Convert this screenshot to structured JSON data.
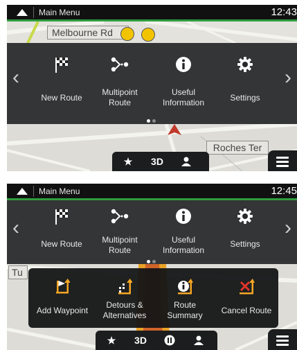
{
  "colors": {
    "accent_green": "#2e9d3e",
    "accent_orange": "#f5a623",
    "cancel_red": "#e0342b",
    "panel_dark": "#26282a"
  },
  "screens": [
    {
      "status": {
        "title": "Main Menu",
        "time": "12:43"
      },
      "map": {
        "street_1": "Melbourne Rd",
        "street_2": "Roches Ter"
      },
      "menu": {
        "items": [
          {
            "label": "New Route",
            "icon": "checkered-flag-icon"
          },
          {
            "label_line1": "Multipoint",
            "label_line2": "Route",
            "icon": "multipoint-icon"
          },
          {
            "label_line1": "Useful",
            "label_line2": "Information",
            "icon": "info-icon"
          },
          {
            "label": "Settings",
            "icon": "gear-icon"
          }
        ]
      },
      "bottom_bar": {
        "star": "★",
        "view_mode": "3D",
        "person": "person-icon"
      }
    },
    {
      "status": {
        "title": "Main Menu",
        "time": "12:45"
      },
      "map": {
        "street_1": "Tu"
      },
      "menu": {
        "items": [
          {
            "label": "New Route",
            "icon": "checkered-flag-icon"
          },
          {
            "label_line1": "Multipoint",
            "label_line2": "Route",
            "icon": "multipoint-icon"
          },
          {
            "label_line1": "Useful",
            "label_line2": "Information",
            "icon": "info-icon"
          },
          {
            "label": "Settings",
            "icon": "gear-icon"
          }
        ]
      },
      "route_menu": {
        "items": [
          {
            "label": "Add Waypoint",
            "icon": "add-waypoint-icon"
          },
          {
            "label_line1": "Detours &",
            "label_line2": "Alternatives",
            "icon": "detours-icon"
          },
          {
            "label_line1": "Route",
            "label_line2": "Summary",
            "icon": "route-summary-icon"
          },
          {
            "label": "Cancel Route",
            "icon": "cancel-route-icon"
          }
        ]
      },
      "bottom_bar": {
        "star": "★",
        "view_mode": "3D",
        "pause": "pause-icon",
        "person": "person-icon"
      }
    }
  ]
}
